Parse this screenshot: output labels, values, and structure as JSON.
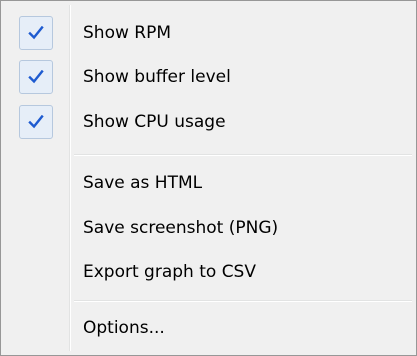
{
  "menu": {
    "items": [
      {
        "label": "Show RPM",
        "checked": true,
        "check_icon": "checkmark-icon"
      },
      {
        "label": "Show buffer level",
        "checked": true,
        "check_icon": "checkmark-icon"
      },
      {
        "label": "Show CPU usage",
        "checked": true,
        "check_icon": "checkmark-icon"
      },
      {
        "label": "Save as HTML"
      },
      {
        "label": "Save screenshot (PNG)"
      },
      {
        "label": "Export graph to CSV"
      },
      {
        "label": "Options..."
      }
    ],
    "colors": {
      "background": "#f0f0f0",
      "check": "#1e5bd0",
      "check_box": "#e6eef8",
      "check_box_border": "#b6c8de",
      "separator": "#e2e3e3"
    }
  }
}
